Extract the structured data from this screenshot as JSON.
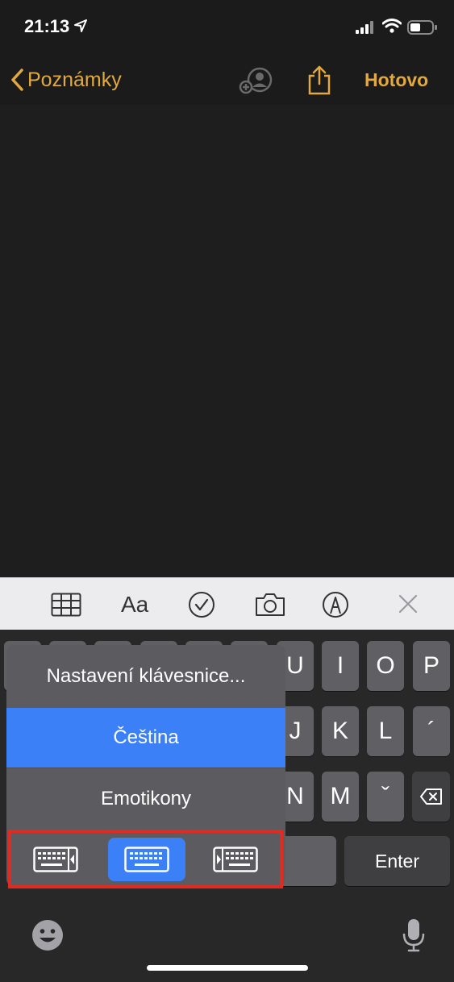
{
  "status_bar": {
    "time": "21:13"
  },
  "nav": {
    "back_label": "Poznámky",
    "done_label": "Hotovo"
  },
  "toolbar": {
    "format_label": "Aa"
  },
  "keyboard": {
    "row1_visible": [
      "U",
      "I",
      "O",
      "P"
    ],
    "row2_visible": [
      "J",
      "K",
      "L",
      "´"
    ],
    "row3_visible": [
      "N",
      "M",
      "ˇ"
    ],
    "enter_label": "Enter"
  },
  "keyboard_menu": {
    "items": [
      "Nastavení klávesnice...",
      "Čeština",
      "Emotikony"
    ],
    "selected": "Čeština",
    "layouts": [
      "keyboard-left-icon",
      "keyboard-full-icon",
      "keyboard-right-icon"
    ],
    "selected_layout": "keyboard-full-icon"
  },
  "colors": {
    "accent": "#e1a93e",
    "selection": "#3b80f7",
    "highlight": "#e12b22"
  }
}
